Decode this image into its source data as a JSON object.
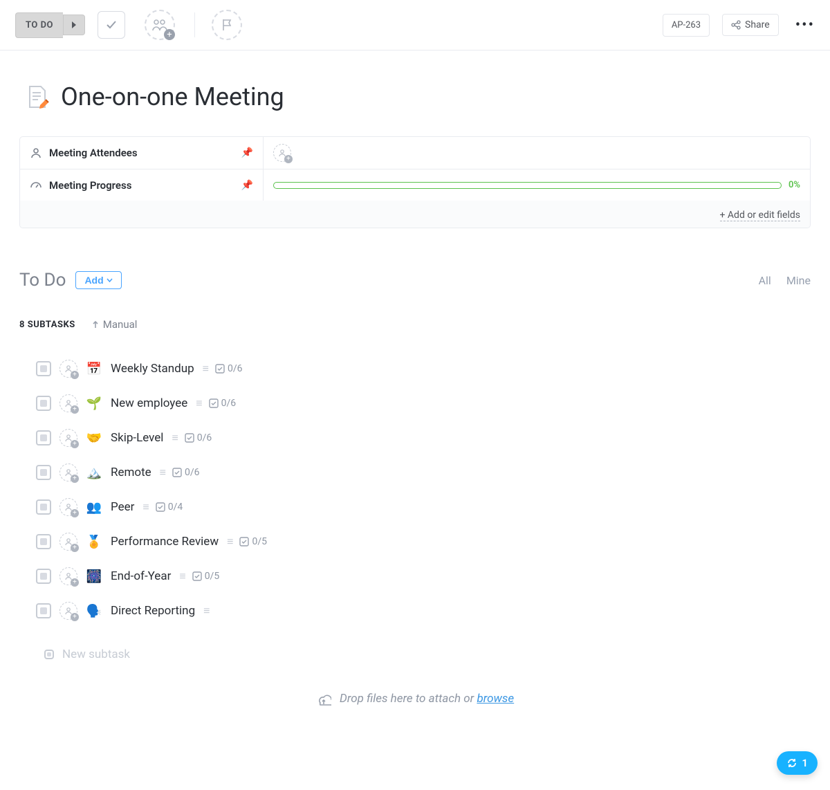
{
  "toolbar": {
    "status_label": "TO DO",
    "task_id": "AP-263",
    "share_label": "Share"
  },
  "title": "One-on-one Meeting",
  "fields": {
    "attendees_label": "Meeting Attendees",
    "progress_label": "Meeting Progress",
    "progress_pct": "0%",
    "add_edit_label": "+ Add or edit fields"
  },
  "todo": {
    "heading": "To Do",
    "add_label": "Add",
    "filter_all": "All",
    "filter_mine": "Mine",
    "subtask_count_label": "8 SUBTASKS",
    "sort_label": "Manual"
  },
  "subtasks": [
    {
      "emoji": "📅",
      "title": "Weekly Standup",
      "counter": "0/6"
    },
    {
      "emoji": "🌱",
      "title": "New employee",
      "counter": "0/6"
    },
    {
      "emoji": "🤝",
      "title": "Skip-Level",
      "counter": "0/6"
    },
    {
      "emoji": "🏔️",
      "title": "Remote",
      "counter": "0/6"
    },
    {
      "emoji": "👥",
      "title": "Peer",
      "counter": "0/4"
    },
    {
      "emoji": "🏅",
      "title": "Performance Review",
      "counter": "0/5"
    },
    {
      "emoji": "🎆",
      "title": "End-of-Year",
      "counter": "0/5"
    },
    {
      "emoji": "🗣️",
      "title": "Direct Reporting",
      "counter": ""
    }
  ],
  "new_subtask_placeholder": "New subtask",
  "dropzone": {
    "prefix": "Drop files here to attach or ",
    "link": "browse"
  },
  "fab_count": "1"
}
